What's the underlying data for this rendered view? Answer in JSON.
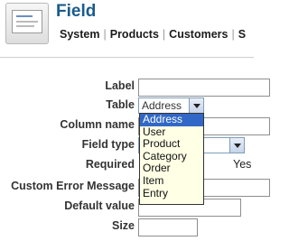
{
  "header": {
    "title": "Field",
    "nav": [
      "System",
      "Products",
      "Customers",
      "S"
    ]
  },
  "form": {
    "label": {
      "label": "Label",
      "value": ""
    },
    "table": {
      "label": "Table",
      "value": "Address"
    },
    "column_name": {
      "label": "Column name",
      "value": ""
    },
    "field_type": {
      "label": "Field type",
      "value": ""
    },
    "required": {
      "label": "Required",
      "value_text": "Yes"
    },
    "custom_error": {
      "label": "Custom Error Message",
      "value": ""
    },
    "default_value": {
      "label": "Default value",
      "value": ""
    },
    "size": {
      "label": "Size",
      "value": ""
    }
  },
  "dropdown": {
    "options": [
      "Address",
      "User",
      "Product",
      "Category",
      "Order",
      "Item",
      "Entry"
    ],
    "selected": "Address"
  },
  "colors": {
    "title": "#1a5b8c",
    "selection": "#3168c6",
    "dropdown_bg": "#ffffe6"
  }
}
